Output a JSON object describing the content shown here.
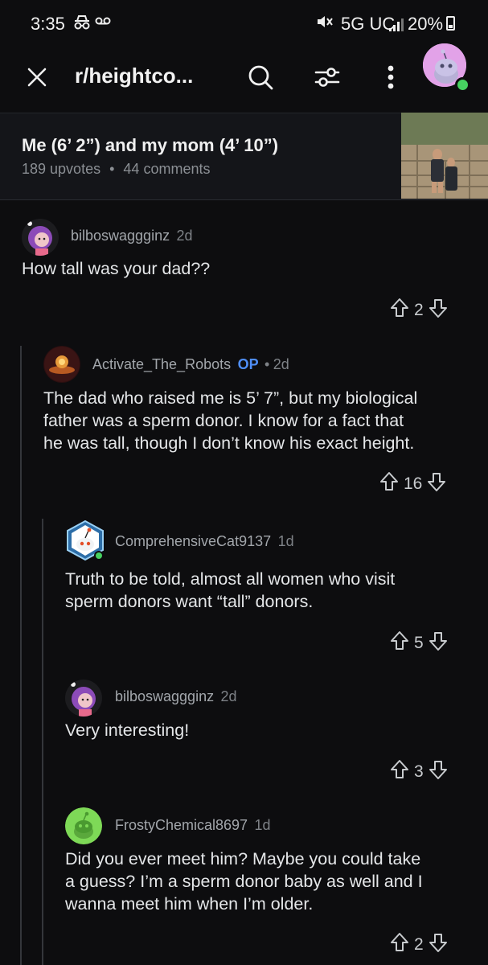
{
  "status": {
    "time": "3:35",
    "network": "5G UC",
    "battery": "20%"
  },
  "header": {
    "subreddit": "r/heightco..."
  },
  "post": {
    "title": "Me (6’ 2”) and my mom (4’ 10”)",
    "upvotes": "189 upvotes",
    "separator": "•",
    "comments": "44 comments"
  },
  "comments": [
    {
      "user": "bilboswaggginz",
      "age": "2d",
      "text": "How tall was your dad??",
      "score": "2"
    },
    {
      "user": "Activate_The_Robots",
      "badge": "OP",
      "sep": "•",
      "age": "2d",
      "text_lines": [
        "The dad who raised me is 5’ 7”, but my biological",
        "father was a sperm donor. I know for a fact that",
        "he was tall, though I don’t know his exact height."
      ],
      "score": "16"
    },
    {
      "user": "ComprehensiveCat9137",
      "age": "1d",
      "text_lines": [
        "Truth to be told, almost all women who visit",
        "sperm donors want “tall” donors."
      ],
      "score": "5"
    },
    {
      "user": "bilboswaggginz",
      "age": "2d",
      "text": "Very interesting!",
      "score": "3"
    },
    {
      "user": "FrostyChemical8697",
      "age": "1d",
      "text_lines": [
        "Did you ever meet him? Maybe you could take",
        "a guess? I’m a sperm donor baby as well and I",
        "wanna meet him when I’m older."
      ],
      "score": "2"
    }
  ],
  "colors": {
    "background": "#0d0d0f",
    "op_badge": "#4f8ef7",
    "online": "#46d160"
  },
  "icons": [
    "close-icon",
    "search-icon",
    "filter-icon",
    "more-vertical-icon",
    "upvote-icon",
    "downvote-icon"
  ]
}
